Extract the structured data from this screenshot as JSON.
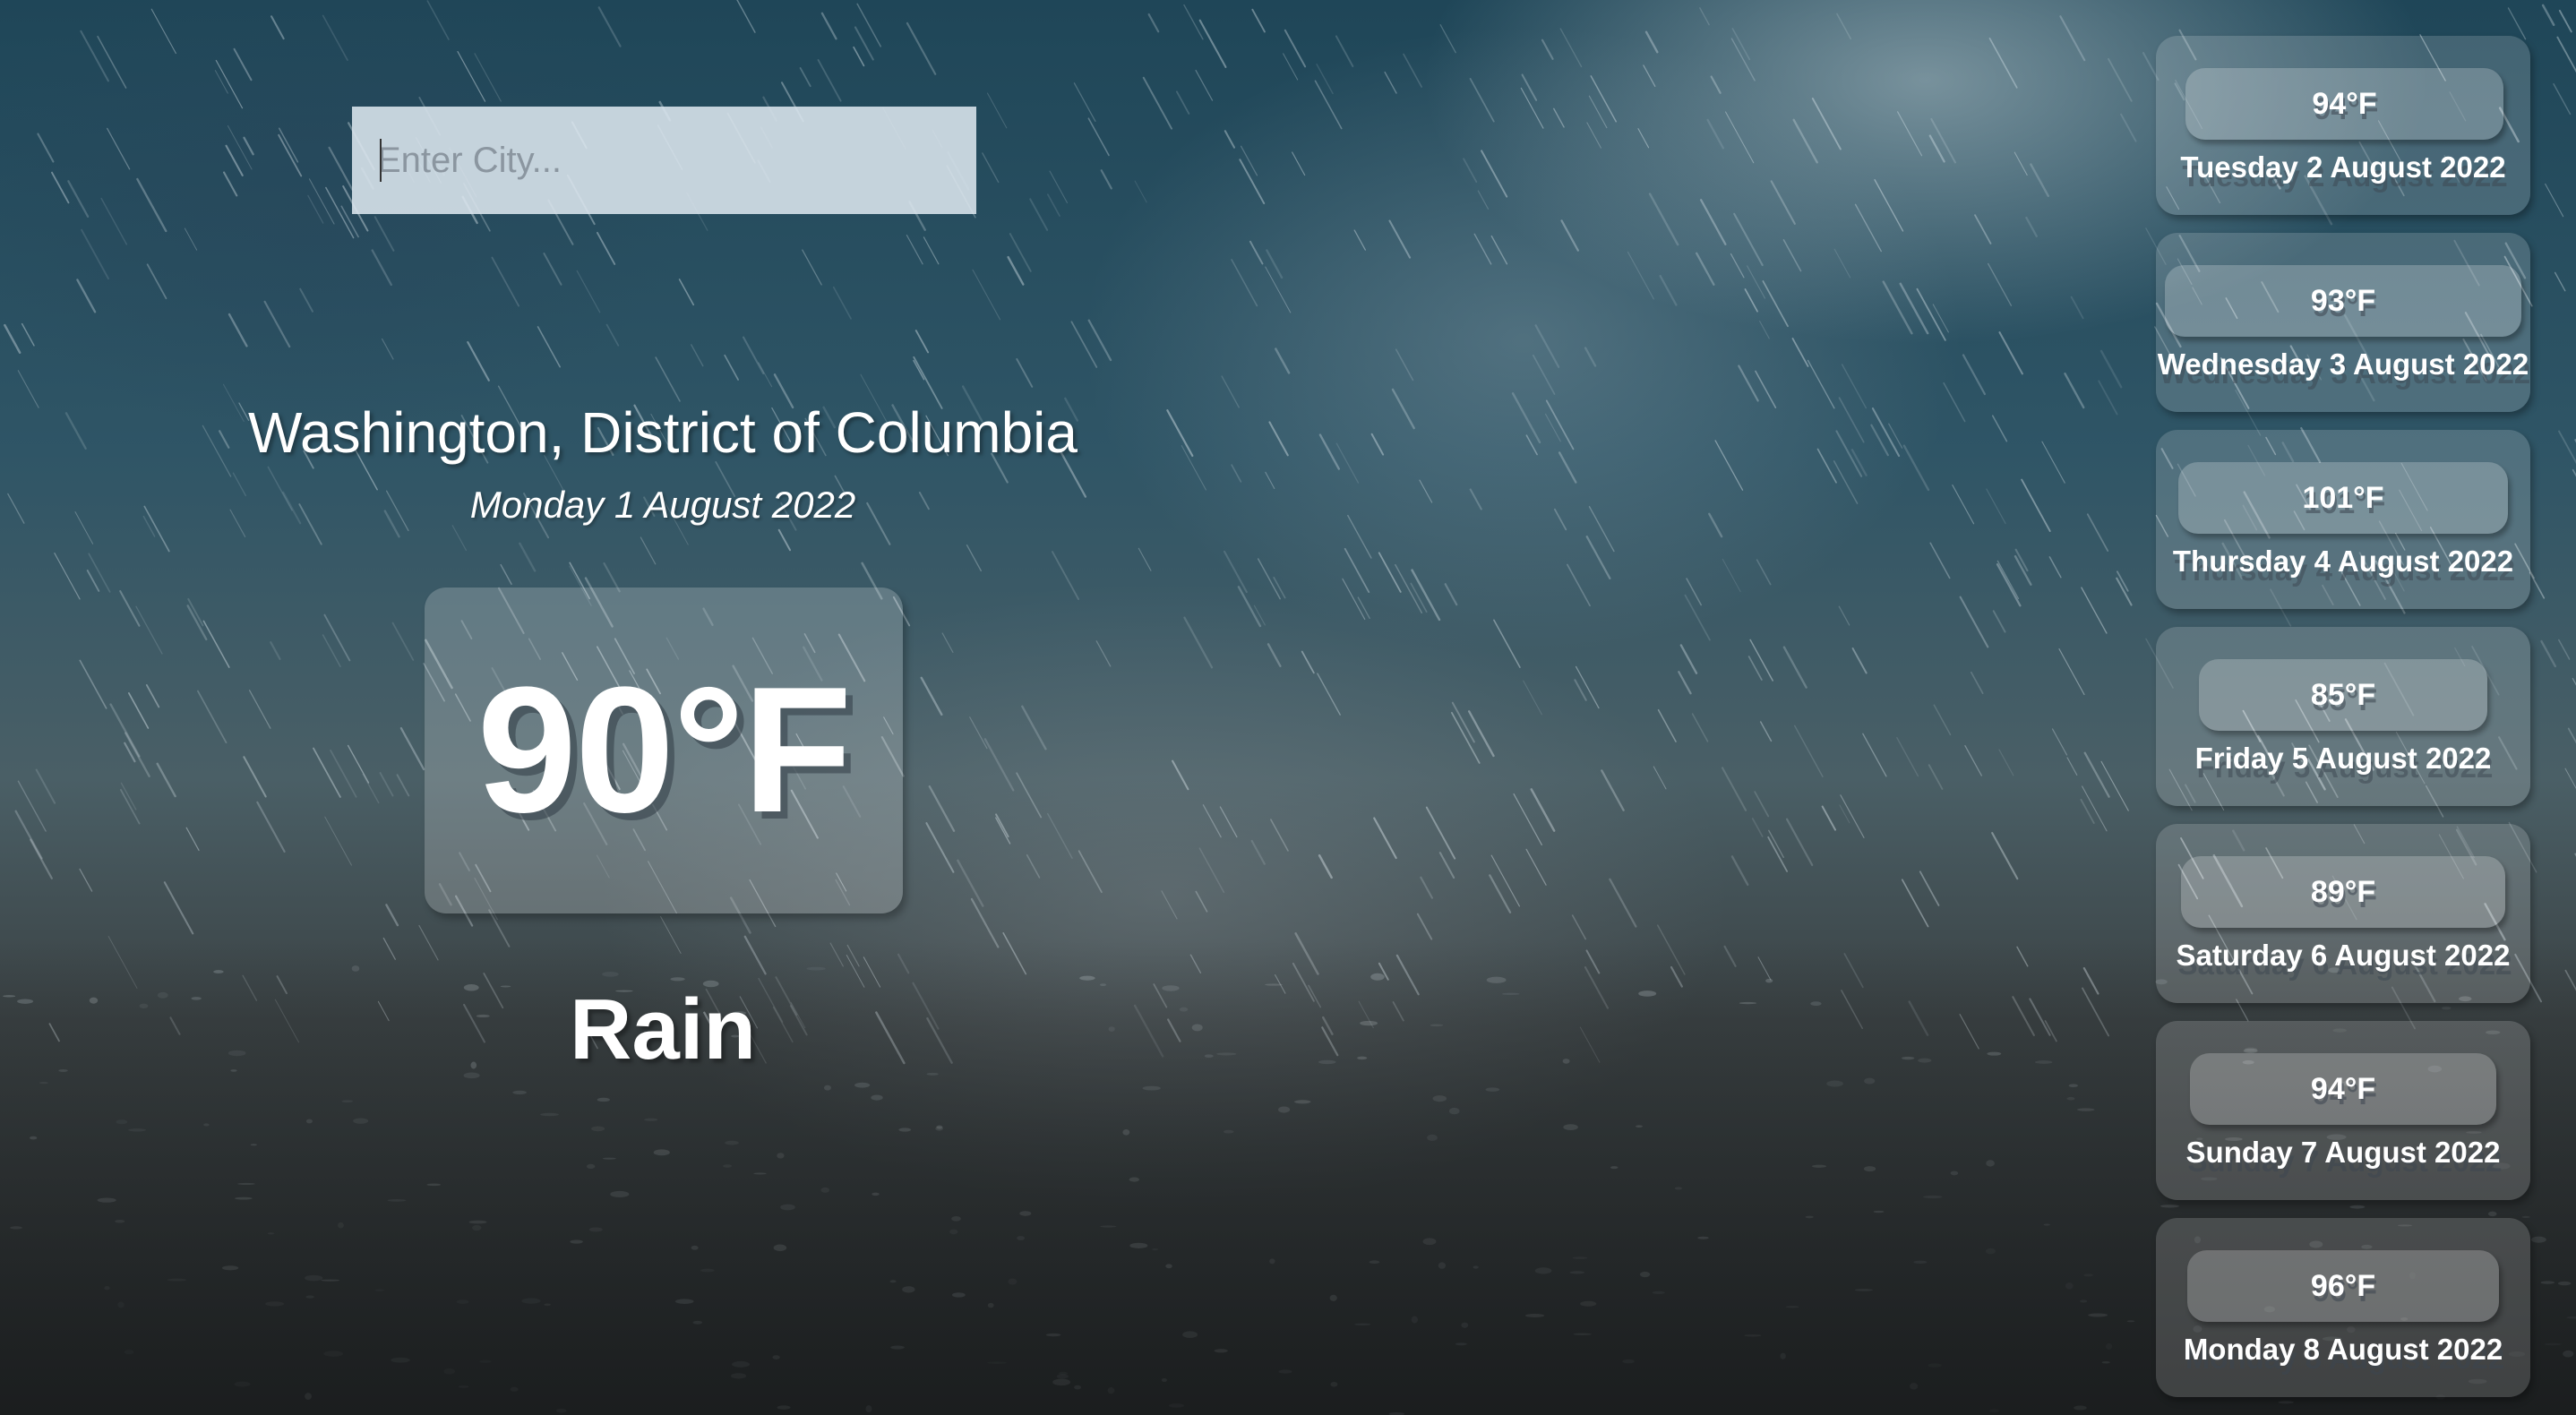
{
  "search": {
    "placeholder": "Enter City..."
  },
  "current": {
    "location": "Washington, District of Columbia",
    "date": "Monday 1 August 2022",
    "temperature": "90°F",
    "condition": "Rain"
  },
  "forecast": [
    {
      "temperature": "94°F",
      "date": "Tuesday 2 August 2022"
    },
    {
      "temperature": "93°F",
      "date": "Wednesday 3 August 2022"
    },
    {
      "temperature": "101°F",
      "date": "Thursday 4 August 2022"
    },
    {
      "temperature": "85°F",
      "date": "Friday 5 August 2022"
    },
    {
      "temperature": "89°F",
      "date": "Saturday 6 August 2022"
    },
    {
      "temperature": "94°F",
      "date": "Sunday 7 August 2022"
    },
    {
      "temperature": "96°F",
      "date": "Monday 8 August 2022"
    }
  ],
  "background": {
    "theme": "rain"
  }
}
